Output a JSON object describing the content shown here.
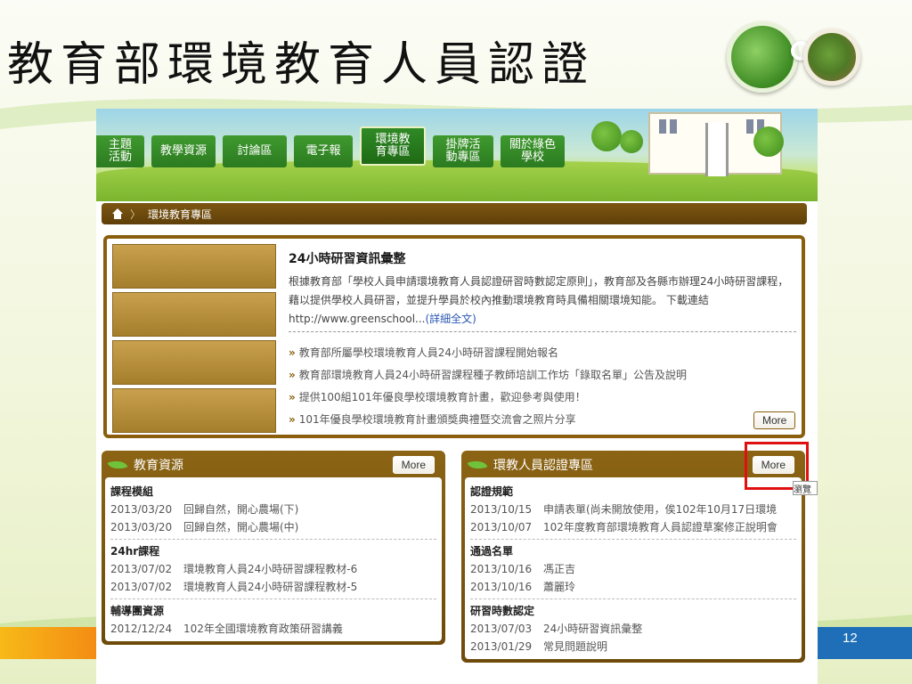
{
  "slide": {
    "title": "教育部環境教育人員認證",
    "page_number": "12"
  },
  "nav": {
    "tabs": [
      {
        "label": "主題活動"
      },
      {
        "label": "教學資源"
      },
      {
        "label": "討論區"
      },
      {
        "label": "電子報"
      },
      {
        "label": "環境教育專區",
        "active": true
      },
      {
        "label": "掛牌活動專區"
      },
      {
        "label": "關於綠色學校"
      }
    ]
  },
  "breadcrumb": {
    "current": "環境教育專區"
  },
  "feature": {
    "title": "24小時研習資訊彙整",
    "body": "根據教育部「學校人員申請環境教育人員認證研習時數認定原則」，教育部及各縣市辦理24小時研習課程，藉以提供學校人員研習，並提升學員於校內推動環境教育時具備相關環境知能。 下載連結 http://www.greenschool...",
    "detail_link": "(詳細全文)",
    "news": [
      "教育部所屬學校環境教育人員24小時研習課程開始報名",
      "教育部環境教育人員24小時研習課程種子教師培訓工作坊「錄取名單」公告及說明",
      "提供100組101年優良學校環境教育計畫，歡迎參考與使用！",
      "101年優良學校環境教育計畫頒獎典禮暨交流會之照片分享"
    ],
    "more_label": "More"
  },
  "panels": {
    "left": {
      "title": "教育資源",
      "more_label": "More",
      "sections": [
        {
          "heading": "課程模組",
          "rows": [
            {
              "date": "2013/03/20",
              "text": "回歸自然，開心農場(下)"
            },
            {
              "date": "2013/03/20",
              "text": "回歸自然，開心農場(中)"
            }
          ]
        },
        {
          "heading": "24hr課程",
          "rows": [
            {
              "date": "2013/07/02",
              "text": "環境教育人員24小時研習課程教材-6"
            },
            {
              "date": "2013/07/02",
              "text": "環境教育人員24小時研習課程教材-5"
            }
          ]
        },
        {
          "heading": "輔導團資源",
          "rows": [
            {
              "date": "2012/12/24",
              "text": "102年全國環境教育政策研習講義"
            }
          ]
        }
      ]
    },
    "right": {
      "title": "環教人員認證專區",
      "more_label": "More",
      "sections": [
        {
          "heading": "認證規範",
          "rows": [
            {
              "date": "2013/10/15",
              "text": "申請表單(尚未開放使用，俟102年10月17日環境"
            },
            {
              "date": "2013/10/07",
              "text": "102年度教育部環境教育人員認證草案修正說明會"
            }
          ]
        },
        {
          "heading": "通過名單",
          "rows": [
            {
              "date": "2013/10/16",
              "text": "馮正吉"
            },
            {
              "date": "2013/10/16",
              "text": "蕭麗玲"
            }
          ]
        },
        {
          "heading": "研習時數認定",
          "rows": [
            {
              "date": "2013/07/03",
              "text": "24小時研習資訊彙整"
            },
            {
              "date": "2013/01/29",
              "text": "常見問題說明"
            }
          ]
        }
      ]
    }
  },
  "tooltip": "瀏覽",
  "colors": {
    "nav_green": "#2b7a20",
    "brown": "#8b5e0e",
    "highlight_red": "#e01010",
    "link_blue": "#2a57b3"
  },
  "icons": [
    "home-icon",
    "leaf-icon",
    "raquo-icon"
  ]
}
